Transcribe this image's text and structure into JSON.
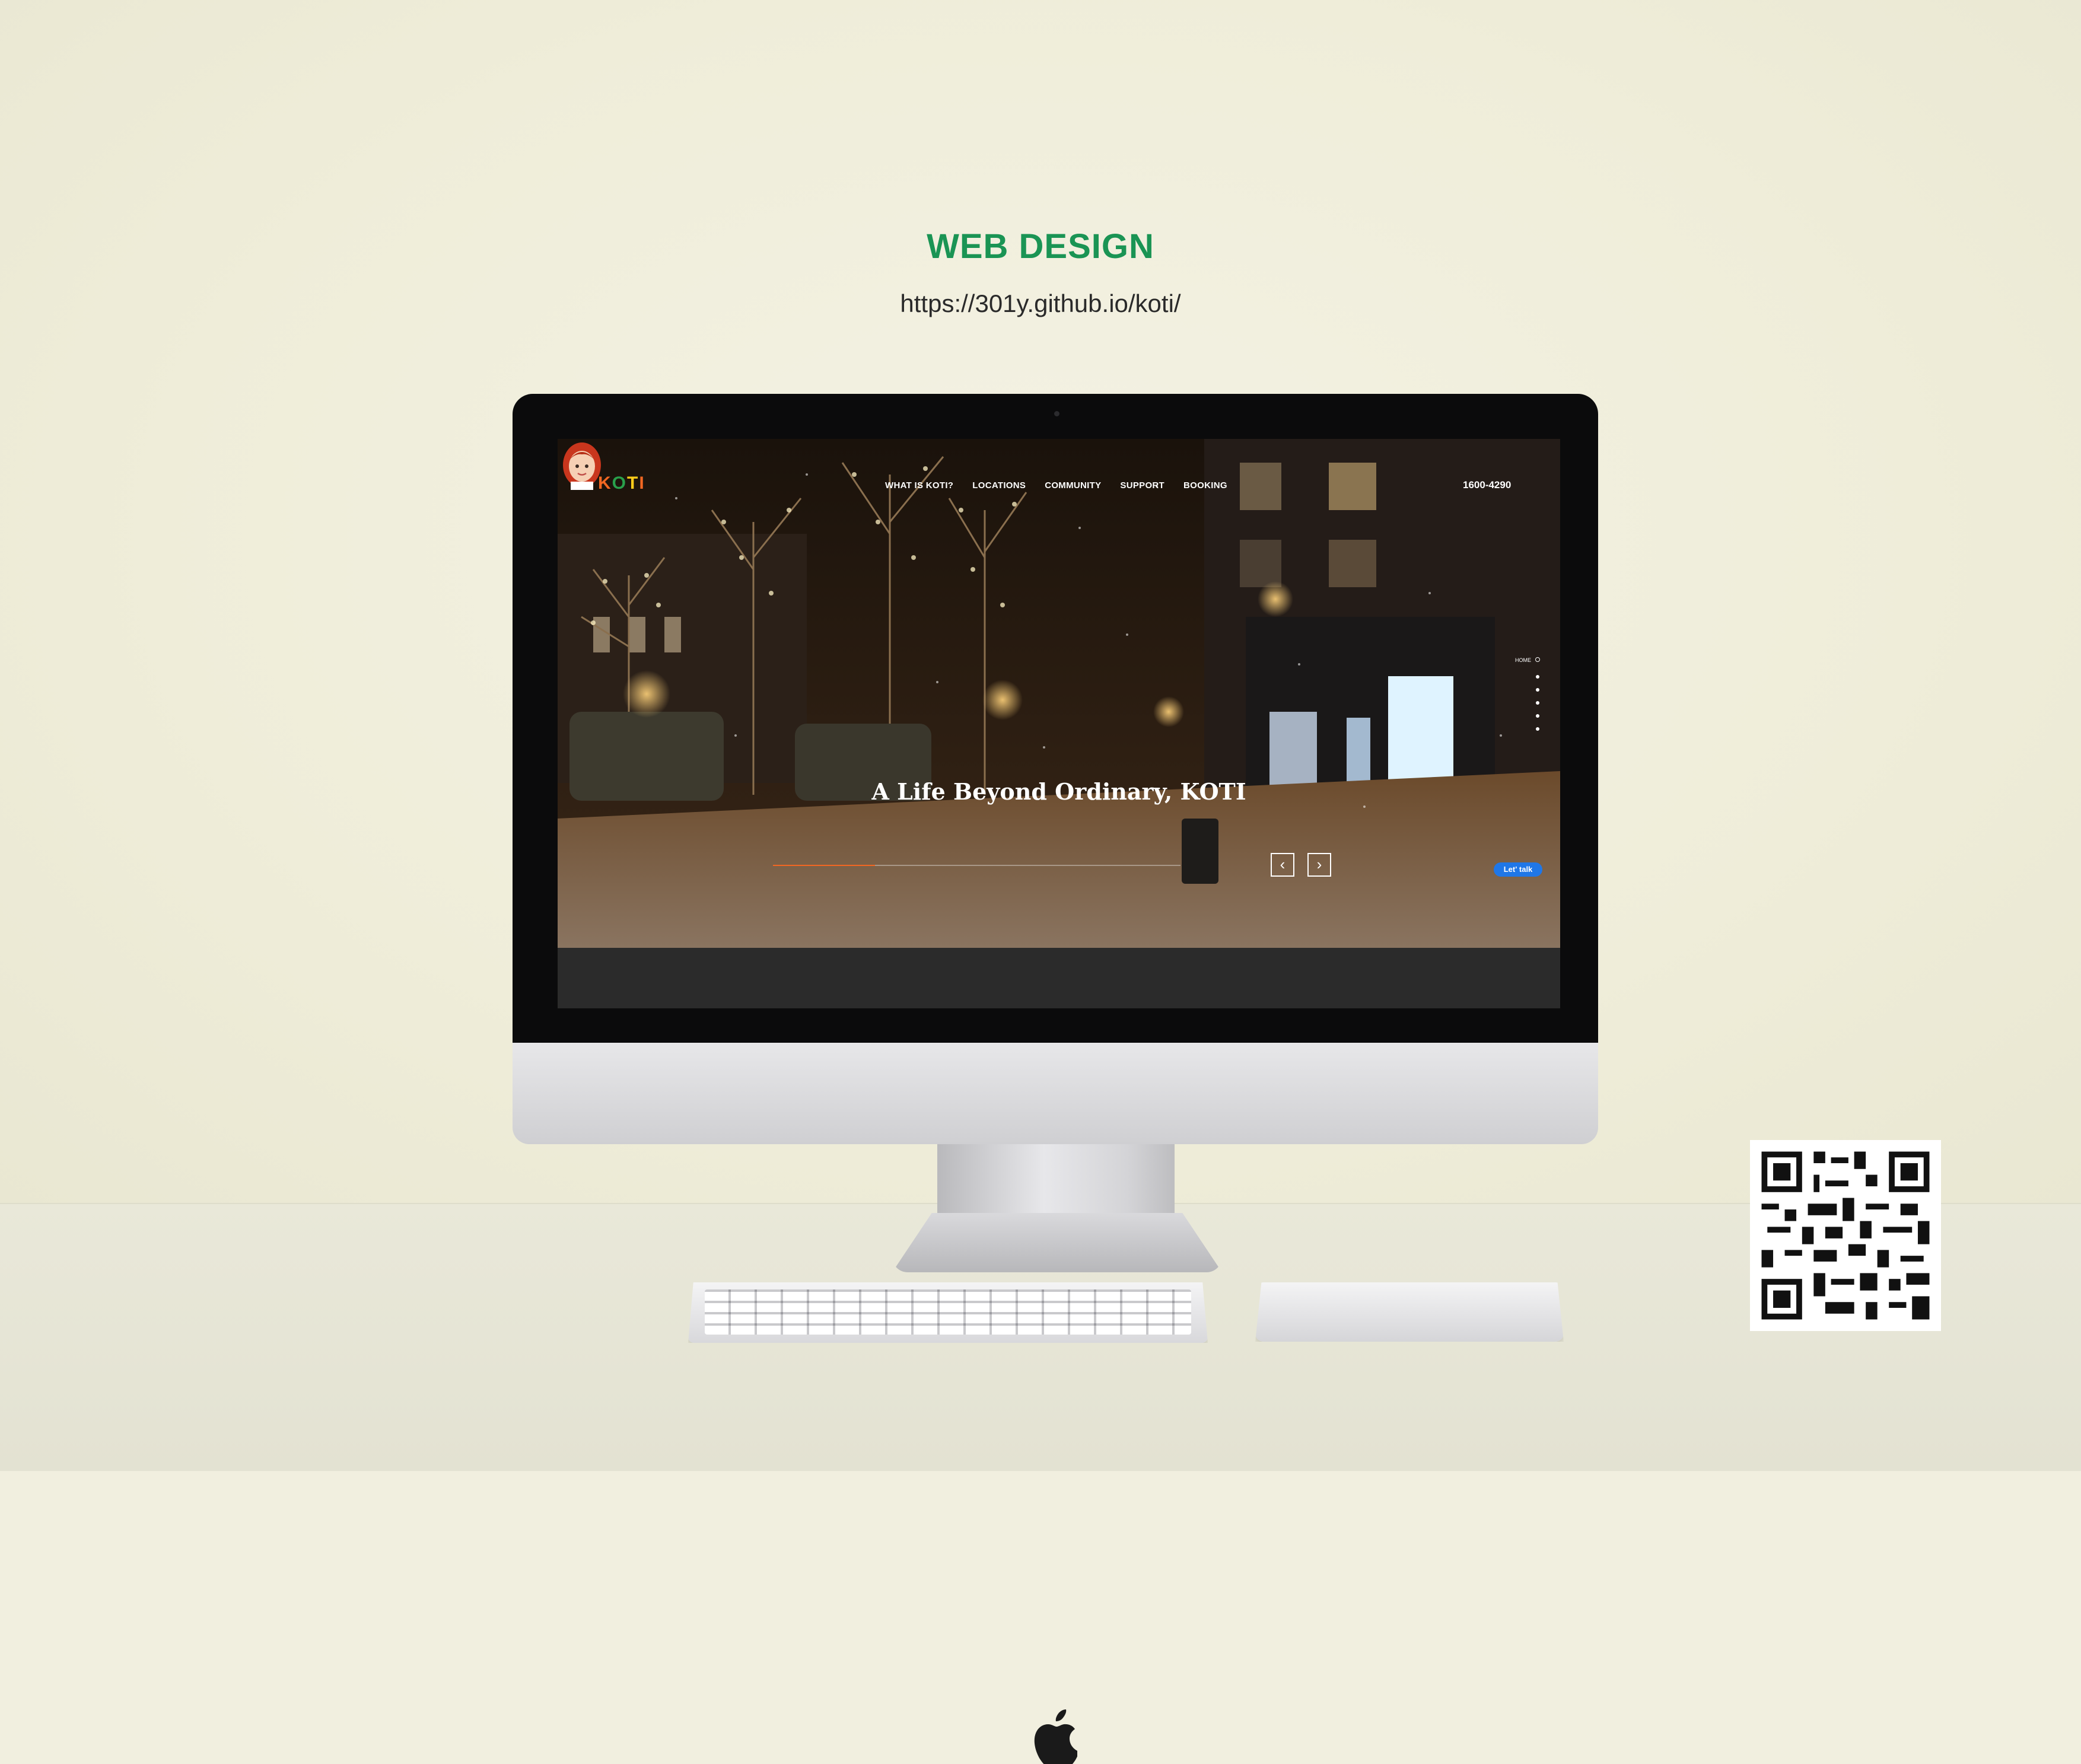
{
  "page": {
    "title": "WEB DESIGN",
    "url": "https://301y.github.io/koti/"
  },
  "site": {
    "logo_text": {
      "k": "K",
      "o": "O",
      "t": "T",
      "i": "I"
    },
    "nav": [
      {
        "label": "WHAT IS KOTI?"
      },
      {
        "label": "LOCATIONS"
      },
      {
        "label": "COMMUNITY"
      },
      {
        "label": "SUPPORT"
      },
      {
        "label": "BOOKING"
      }
    ],
    "phone": "1600-4290",
    "side_nav_label": "HOME",
    "headline": "A Life Beyond Ordinary, KOTI",
    "slide_progress": 0.25,
    "chat_label": "Let' talk"
  },
  "icons": {
    "prev": "chevron-left-icon",
    "next": "chevron-right-icon",
    "apple": "apple-logo",
    "qr": "qr-code"
  },
  "colors": {
    "title_green": "#1a9454",
    "accent_orange": "#f26722",
    "chat_blue": "#1f77e8"
  }
}
